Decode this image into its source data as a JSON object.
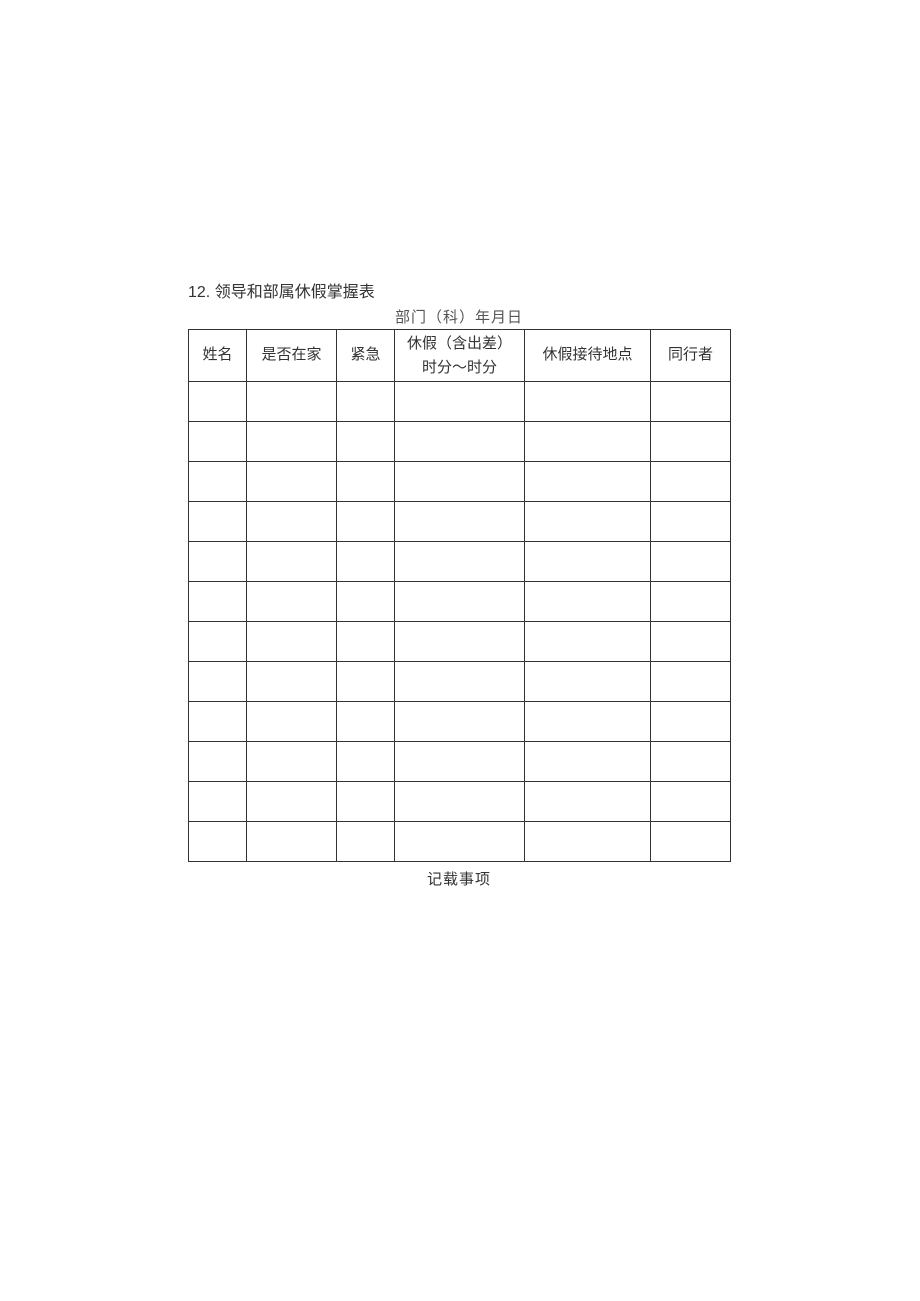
{
  "doc": {
    "title_number": "12.",
    "title_text": "领导和部属休假掌握表",
    "subtitle": "部门（科）年月日",
    "footer": "记载事项"
  },
  "columns": {
    "name": "姓名",
    "at_home": "是否在家",
    "urgent": "紧急",
    "vacation_line1": "休假（含出差）",
    "vacation_line2": "时分～时分",
    "location": "休假接待地点",
    "companion": "同行者"
  },
  "rows": [
    {
      "name": "",
      "at_home": "",
      "urgent": "",
      "vacation": "",
      "location": "",
      "companion": ""
    },
    {
      "name": "",
      "at_home": "",
      "urgent": "",
      "vacation": "",
      "location": "",
      "companion": ""
    },
    {
      "name": "",
      "at_home": "",
      "urgent": "",
      "vacation": "",
      "location": "",
      "companion": ""
    },
    {
      "name": "",
      "at_home": "",
      "urgent": "",
      "vacation": "",
      "location": "",
      "companion": ""
    },
    {
      "name": "",
      "at_home": "",
      "urgent": "",
      "vacation": "",
      "location": "",
      "companion": ""
    },
    {
      "name": "",
      "at_home": "",
      "urgent": "",
      "vacation": "",
      "location": "",
      "companion": ""
    },
    {
      "name": "",
      "at_home": "",
      "urgent": "",
      "vacation": "",
      "location": "",
      "companion": ""
    },
    {
      "name": "",
      "at_home": "",
      "urgent": "",
      "vacation": "",
      "location": "",
      "companion": ""
    },
    {
      "name": "",
      "at_home": "",
      "urgent": "",
      "vacation": "",
      "location": "",
      "companion": ""
    },
    {
      "name": "",
      "at_home": "",
      "urgent": "",
      "vacation": "",
      "location": "",
      "companion": ""
    },
    {
      "name": "",
      "at_home": "",
      "urgent": "",
      "vacation": "",
      "location": "",
      "companion": ""
    },
    {
      "name": "",
      "at_home": "",
      "urgent": "",
      "vacation": "",
      "location": "",
      "companion": ""
    }
  ]
}
